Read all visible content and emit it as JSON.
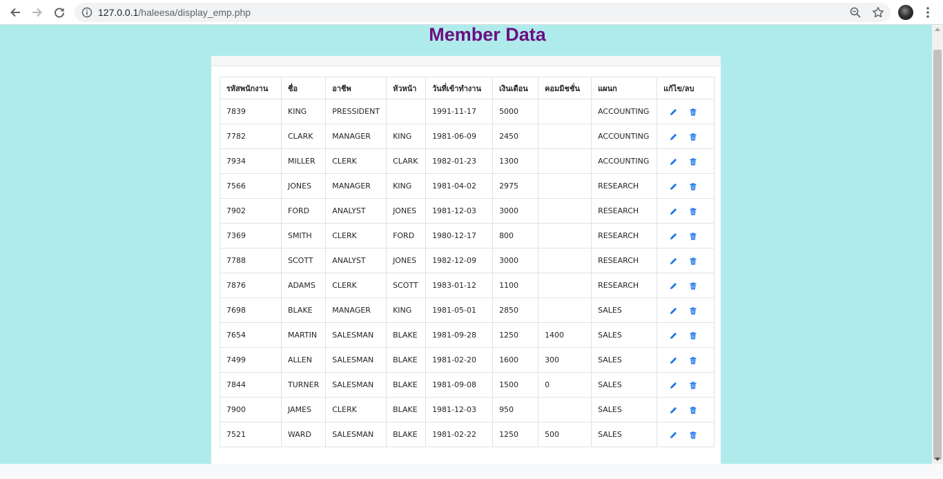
{
  "browser": {
    "url_host": "127.0.0.1",
    "url_path": "/haleesa/display_emp.php"
  },
  "page": {
    "title": "Member Data"
  },
  "table": {
    "headers": [
      "รหัสพนักงาน",
      "ชื่อ",
      "อาชีพ",
      "หัวหน้า",
      "วันที่เข้าทำงาน",
      "เงินเดือน",
      "คอมมิชชั่น",
      "แผนก",
      "แก้ไข/ลบ"
    ],
    "rows": [
      [
        "7839",
        "KING",
        "PRESSIDENT",
        "",
        "1991-11-17",
        "5000",
        "",
        "ACCOUNTING"
      ],
      [
        "7782",
        "CLARK",
        "MANAGER",
        "KING",
        "1981-06-09",
        "2450",
        "",
        "ACCOUNTING"
      ],
      [
        "7934",
        "MILLER",
        "CLERK",
        "CLARK",
        "1982-01-23",
        "1300",
        "",
        "ACCOUNTING"
      ],
      [
        "7566",
        "JONES",
        "MANAGER",
        "KING",
        "1981-04-02",
        "2975",
        "",
        "RESEARCH"
      ],
      [
        "7902",
        "FORD",
        "ANALYST",
        "JONES",
        "1981-12-03",
        "3000",
        "",
        "RESEARCH"
      ],
      [
        "7369",
        "SMITH",
        "CLERK",
        "FORD",
        "1980-12-17",
        "800",
        "",
        "RESEARCH"
      ],
      [
        "7788",
        "SCOTT",
        "ANALYST",
        "JONES",
        "1982-12-09",
        "3000",
        "",
        "RESEARCH"
      ],
      [
        "7876",
        "ADAMS",
        "CLERK",
        "SCOTT",
        "1983-01-12",
        "1100",
        "",
        "RESEARCH"
      ],
      [
        "7698",
        "BLAKE",
        "MANAGER",
        "KING",
        "1981-05-01",
        "2850",
        "",
        "SALES"
      ],
      [
        "7654",
        "MARTIN",
        "SALESMAN",
        "BLAKE",
        "1981-09-28",
        "1250",
        "1400",
        "SALES"
      ],
      [
        "7499",
        "ALLEN",
        "SALESMAN",
        "BLAKE",
        "1981-02-20",
        "1600",
        "300",
        "SALES"
      ],
      [
        "7844",
        "TURNER",
        "SALESMAN",
        "BLAKE",
        "1981-09-08",
        "1500",
        "0",
        "SALES"
      ],
      [
        "7900",
        "JAMES",
        "CLERK",
        "BLAKE",
        "1981-12-03",
        "950",
        "",
        "SALES"
      ],
      [
        "7521",
        "WARD",
        "SALESMAN",
        "BLAKE",
        "1981-02-22",
        "1250",
        "500",
        "SALES"
      ]
    ],
    "action_icons": [
      "edit-icon",
      "trash-icon"
    ]
  },
  "colors": {
    "page_background": "#b0ebec",
    "title": "#6b0f82",
    "action_icon": "#1a73e8"
  }
}
